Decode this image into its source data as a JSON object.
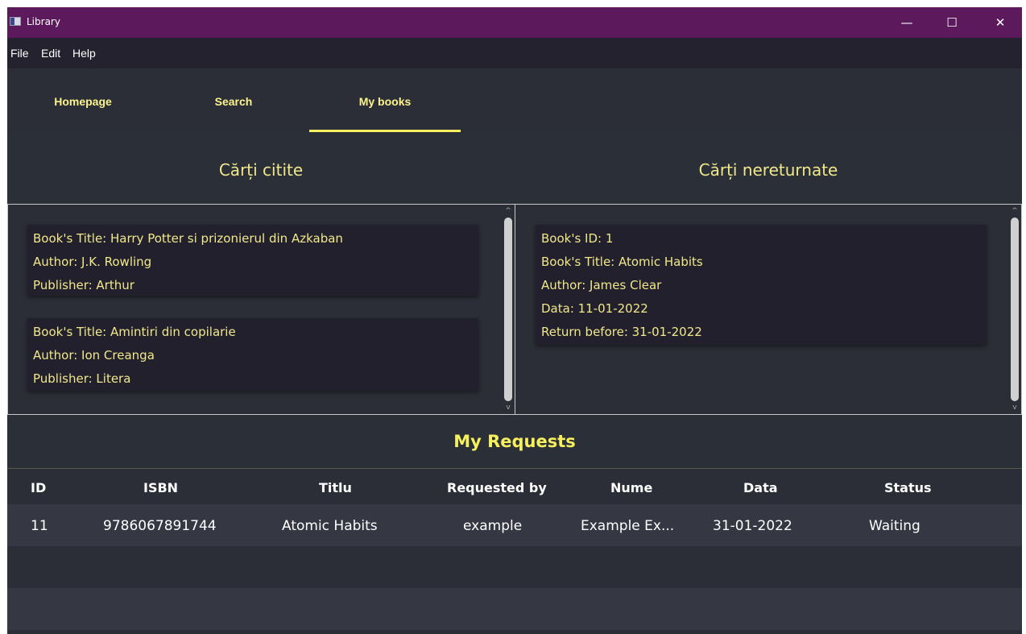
{
  "window": {
    "title": "Library",
    "minimize": "—",
    "maximize": "☐",
    "close": "✕"
  },
  "menu": [
    {
      "label": "File"
    },
    {
      "label": "Edit"
    },
    {
      "label": "Help"
    }
  ],
  "tabs": [
    {
      "label": "Homepage",
      "active": false
    },
    {
      "label": "Search",
      "active": false
    },
    {
      "label": "My books",
      "active": true
    }
  ],
  "read_books": {
    "title": "Cărți citite",
    "items": [
      {
        "title": "Book's Title: Harry Potter si prizonierul din Azkaban",
        "author": "Author: J.K. Rowling",
        "publisher": "Publisher: Arthur"
      },
      {
        "title": "Book's Title: Amintiri din copilarie",
        "author": "Author: Ion Creanga",
        "publisher": "Publisher: Litera"
      }
    ]
  },
  "unreturned_books": {
    "title": "Cărți nereturnate",
    "items": [
      {
        "id": "Book's ID: 1",
        "title": "Book's Title: Atomic Habits",
        "author": "Author: James Clear",
        "date": "Data: 11-01-2022",
        "return_before": "Return before: 31-01-2022"
      }
    ]
  },
  "requests": {
    "title": "My Requests",
    "columns": [
      "ID",
      "ISBN",
      "Titlu",
      "Requested by",
      "Nume",
      "Data",
      "Status"
    ],
    "rows": [
      {
        "id": "11",
        "isbn": "9786067891744",
        "titlu": "Atomic Habits",
        "requested_by": "example",
        "nume": "Example Ex...",
        "data": "31-01-2022",
        "status": "Waiting"
      }
    ]
  },
  "colors": {
    "accent": "#f6ef5e",
    "title_bar": "#5c1a5c",
    "background": "#2b2e36",
    "card": "#23202e"
  }
}
